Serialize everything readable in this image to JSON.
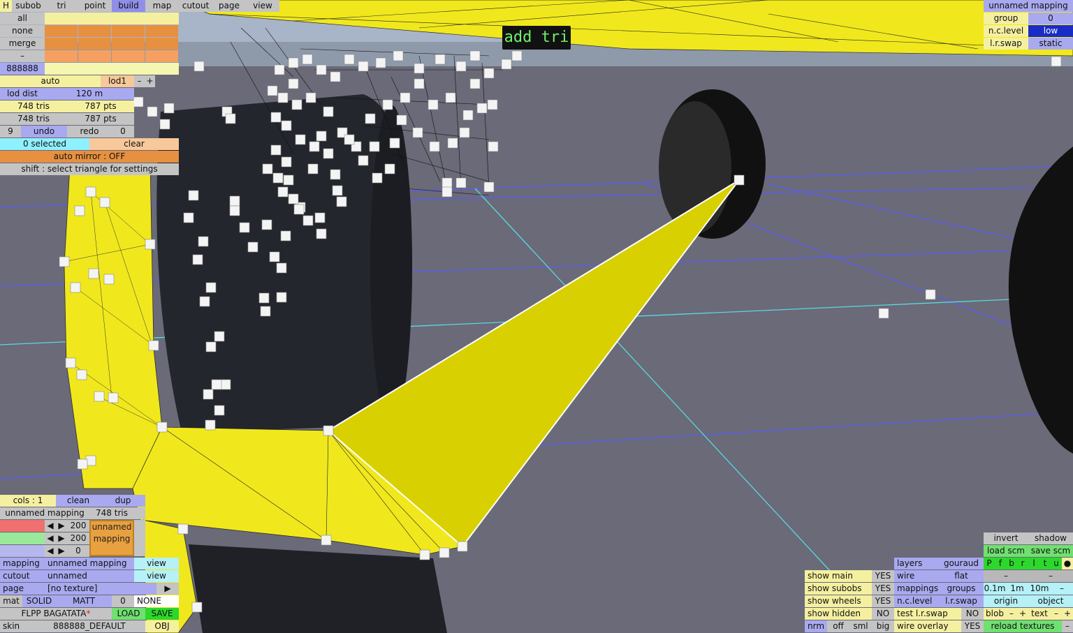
{
  "menu": {
    "h": "H",
    "tabs": [
      "subob",
      "tri",
      "point",
      "build",
      "map",
      "cutout",
      "page",
      "view"
    ],
    "active_tab": "build"
  },
  "selection": {
    "all": "all",
    "none": "none",
    "merge": "merge",
    "dash": "–",
    "color_code": "888888"
  },
  "lod": {
    "auto": "auto",
    "level": "lod1",
    "minus": "–",
    "plus": "+",
    "dist_label": "lod dist",
    "dist_value": "120 m"
  },
  "stats": {
    "tris1": "748 tris",
    "pts1": "787 pts",
    "tris2": "748 tris",
    "pts2": "787 pts"
  },
  "history": {
    "undo_count": "9",
    "undo": "undo",
    "redo": "redo",
    "redo_count": "0"
  },
  "status": {
    "selected": "0 selected",
    "clear": "clear",
    "auto_mirror": "auto mirror : OFF",
    "hint": "shift : select triangle for settings"
  },
  "tooltip": "add tri",
  "mapping_panel": {
    "title": "unnamed mapping",
    "group_label": "group",
    "group_value": "0",
    "nc_label": "n.c.level",
    "nc_value": "low",
    "lr_label": "l.r.swap",
    "lr_value": "static"
  },
  "colors_panel": {
    "cols": "cols : 1",
    "clean": "clean",
    "dup": "dup",
    "mapping_name": "unnamed mapping",
    "tris": "748 tris",
    "v1": "200",
    "v2": "200",
    "v3": "0",
    "preview_line1": "unnamed",
    "preview_line2": "mapping",
    "left": "◀",
    "right": "▶"
  },
  "bottom_left": {
    "mapping_label": "mapping",
    "mapping_value": "unnamed mapping",
    "view1": "view",
    "cutout_label": "cutout",
    "cutout_value": "unnamed",
    "view2": "view",
    "page_label": "page",
    "page_value": "[no texture]",
    "page_arrow": "▶",
    "mat_label": "mat",
    "solid": "SOLID",
    "matt": "MATT",
    "mat_num": "0",
    "none": "NONE",
    "filename": "FLPP BAGATATA",
    "modified": "*",
    "load": "LOAD",
    "save": "SAVE",
    "skin_label": "skin",
    "skin_value": "888888_DEFAULT",
    "obj": "OBJ"
  },
  "view_opts": {
    "show_main": "show main",
    "show_main_v": "YES",
    "show_subobs": "show subobs",
    "show_subobs_v": "YES",
    "show_wheels": "show wheels",
    "show_wheels_v": "YES",
    "show_hidden": "show hidden",
    "show_hidden_v": "NO",
    "nrm": "nrm",
    "off": "off",
    "sml": "sml",
    "big": "big"
  },
  "layers": {
    "layers": "layers",
    "gouraud": "gouraud",
    "wire": "wire",
    "flat": "flat",
    "mappings": "mappings",
    "groups": "groups",
    "nc_level": "n.c.level",
    "lr_swap": "l.r.swap",
    "test_lr": "test l.r.swap",
    "test_lr_v": "NO",
    "wire_overlay": "wire overlay",
    "wire_overlay_v": "YES"
  },
  "right_tools": {
    "invert": "invert",
    "shadow": "shadow",
    "load_scm": "load scm",
    "save_scm": "save scm",
    "flags": [
      "P",
      "f",
      "b",
      "r",
      "l",
      "t",
      "u",
      "●"
    ],
    "dash1": "–",
    "dash2": "–",
    "g01": "0.1m",
    "g1": "1m",
    "g10": "10m",
    "gm": "–",
    "origin": "origin",
    "object": "object",
    "blob": "blob",
    "bm": "–",
    "bp": "+",
    "text": "text",
    "tm": "–",
    "tp": "+",
    "reload": "reload textures",
    "rm": "–"
  },
  "colors": {
    "mesh_yellow": "#f0e81c",
    "ground": "#6a6a78",
    "sky": "#a8b4c8",
    "grid_blue": "#5a5aff",
    "axis_cyan": "#5ad8e0",
    "accent_blue": "#1a2cc8"
  }
}
